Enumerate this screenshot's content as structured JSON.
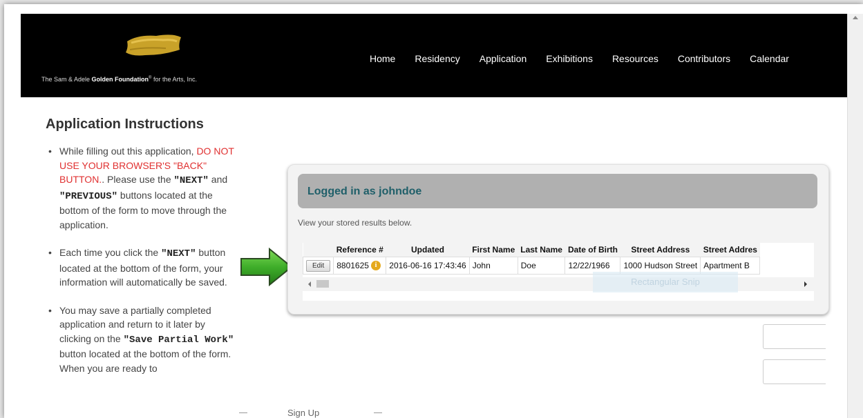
{
  "header": {
    "logo": {
      "prefix": "The Sam & Adele ",
      "brand": "Golden Foundation",
      "suffix": " for the Arts, Inc."
    },
    "nav": [
      "Home",
      "Residency",
      "Application",
      "Exhibitions",
      "Resources",
      "Contributors",
      "Calendar"
    ]
  },
  "instructions": {
    "title": "Application Instructions",
    "b1": {
      "t1": "While filling out this application, ",
      "warn": "DO NOT USE YOUR BROWSER'S \"BACK\" BUTTON.",
      "t2": ". Please use the ",
      "next": "\"NEXT\"",
      "t3": " and ",
      "prev": "\"PREVIOUS\"",
      "t4": " buttons located at the bottom of the form to move through the application."
    },
    "b2": {
      "t1": "Each time you click the ",
      "next": "\"NEXT\"",
      "t2": " button located at the bottom of the form, your information will automatically be saved."
    },
    "b3": {
      "t1": "You may save a partially completed application and return to it later by clicking on the ",
      "save": "\"Save Partial Work\"",
      "t2": " button located at the bottom of the form. When you are ready to"
    }
  },
  "panel": {
    "title": "Logged in as johndoe",
    "description": "View your stored results below.",
    "columns": [
      "Reference #",
      "Updated",
      "First Name",
      "Last Name",
      "Date of Birth",
      "Street Address",
      "Street Addres"
    ],
    "row": {
      "edit": "Edit",
      "reference": "8801625",
      "info_icon": "i",
      "updated": "2016-06-16 17:43:46",
      "first_name": "John",
      "last_name": "Doe",
      "dob": "12/22/1966",
      "street": "1000 Hudson Street",
      "street2": "Apartment B"
    },
    "snip_overlay": "Rectangular Snip"
  },
  "footer": {
    "signup": "Sign Up"
  },
  "colors": {
    "header_bg": "#000000",
    "warning": "#e03030",
    "panel_title": "#1f5f69",
    "arrow": "#3fae2a",
    "info_icon": "#e5a91c"
  },
  "icons": {
    "arrow": "green-right-arrow-icon",
    "info": "info-icon",
    "logo": "gold-paint-stroke-logo"
  }
}
